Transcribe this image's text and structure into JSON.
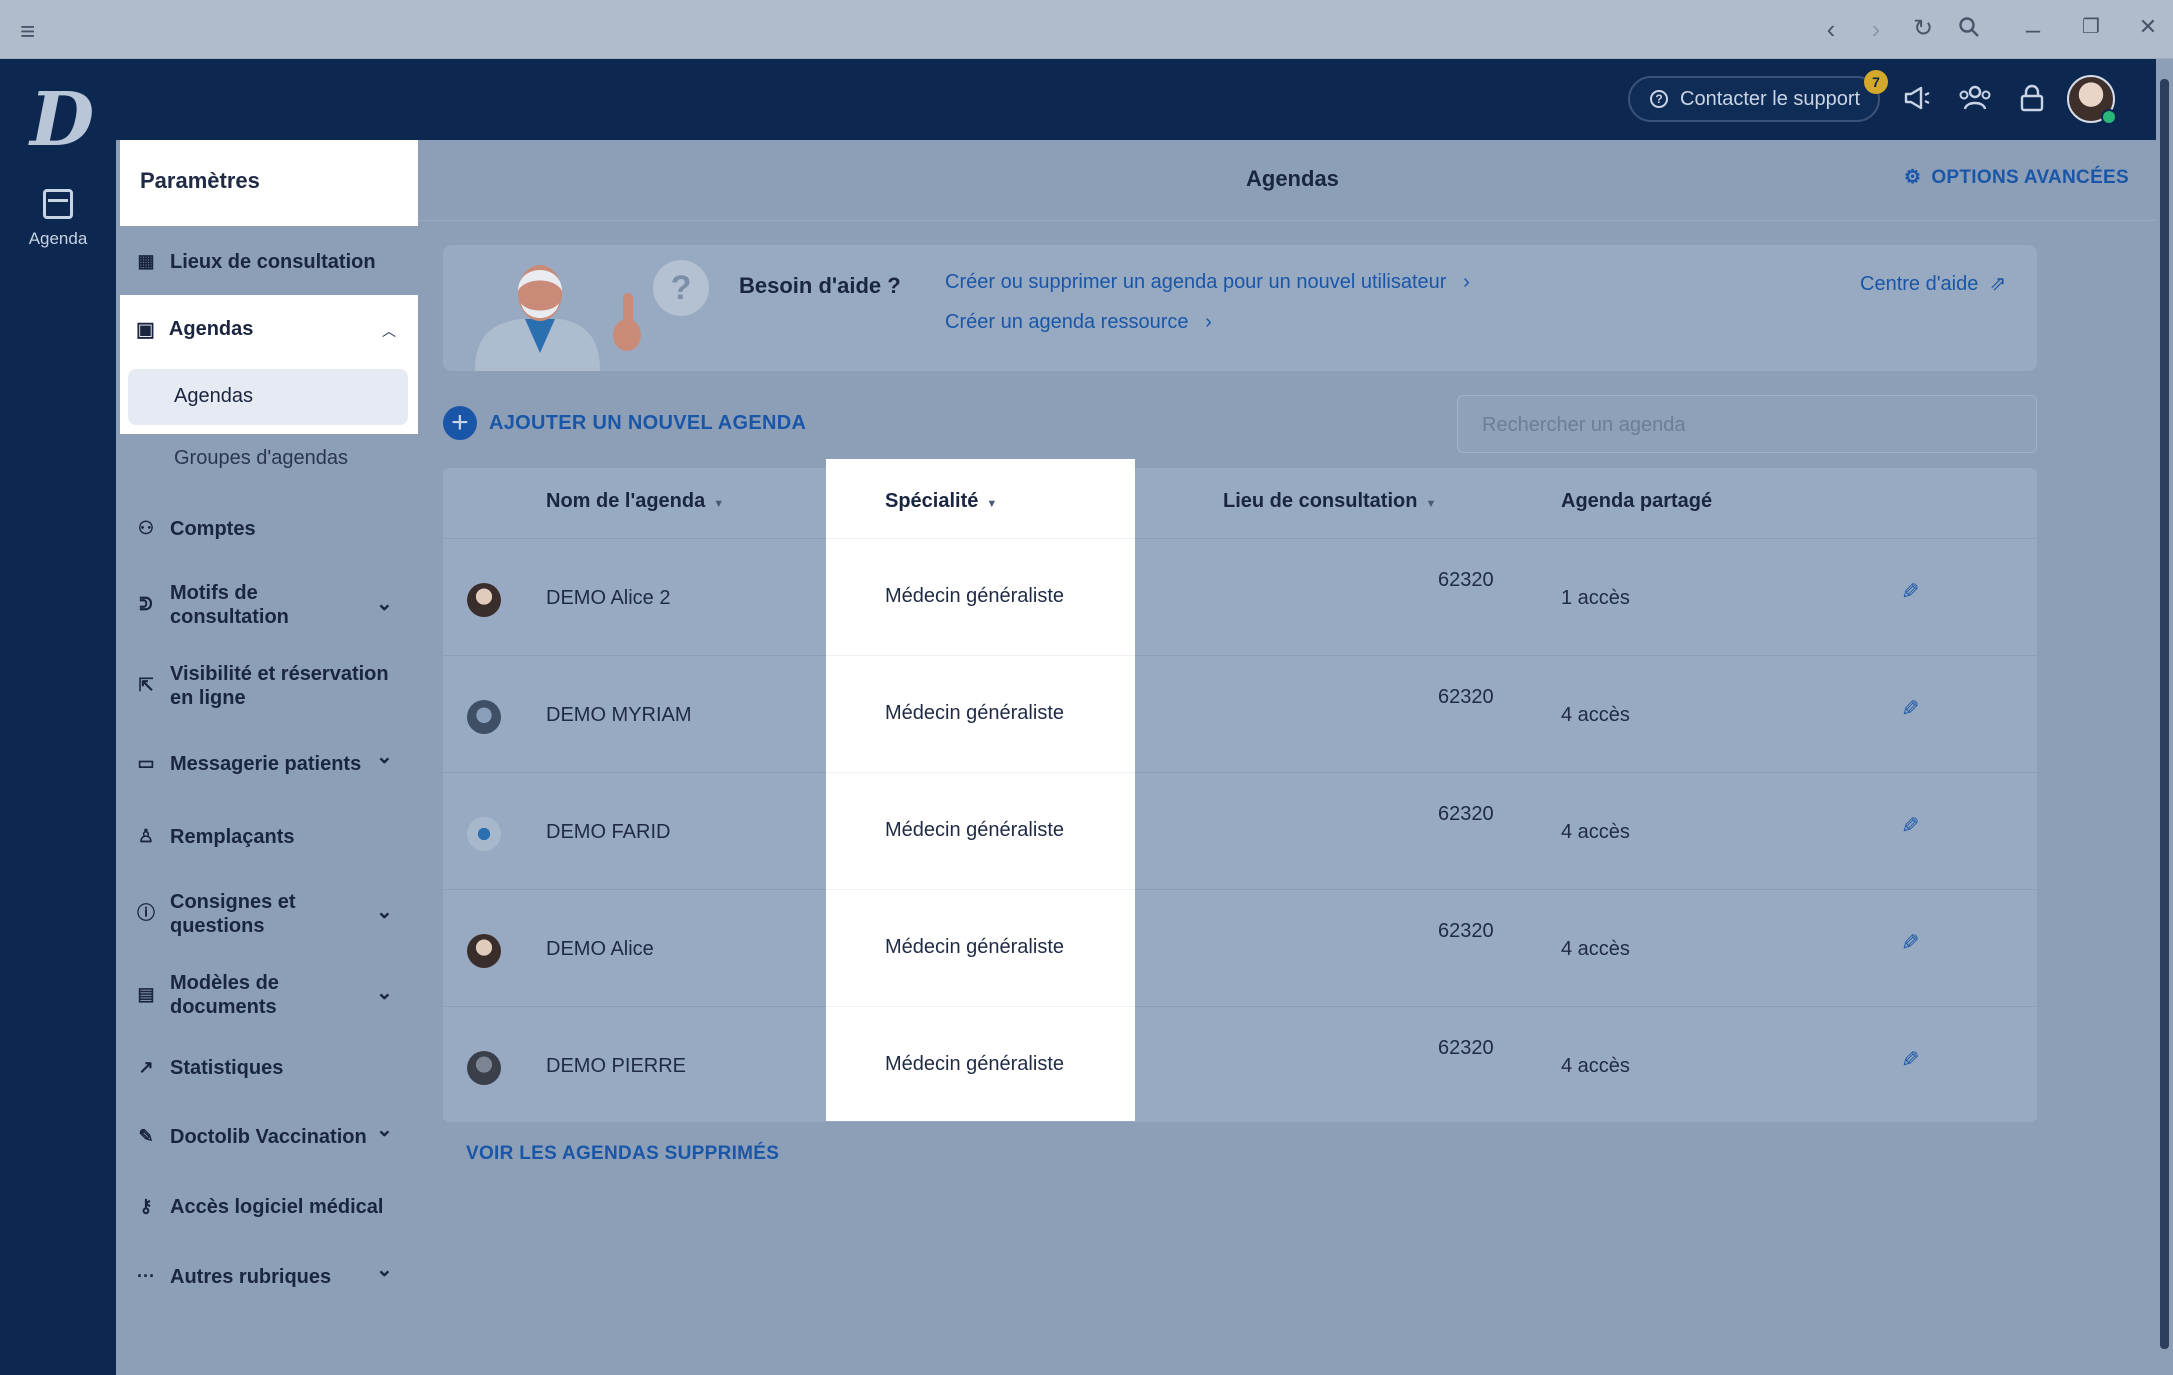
{
  "browser": {
    "menu_icon": "hamburger-icon",
    "controls": [
      "back-icon",
      "forward-icon",
      "reload-icon",
      "search-icon",
      "minimize-icon",
      "restore-icon",
      "close-icon"
    ]
  },
  "rail": {
    "logo": "D",
    "agenda_label": "Agenda"
  },
  "topbar": {
    "support_label": "Contacter le support",
    "support_badge": "7"
  },
  "sidebar": {
    "title": "Paramètres",
    "lieux": "Lieux de consultation",
    "agendas": "Agendas",
    "agendas_sub_active": "Agendas",
    "agendas_sub_groups": "Groupes d'agendas",
    "comptes": "Comptes",
    "motifs": "Motifs de consultation",
    "visibilite": "Visibilité et réservation en ligne",
    "messagerie": "Messagerie patients",
    "remplacants": "Remplaçants",
    "consignes": "Consignes et questions",
    "modeles": "Modèles de documents",
    "statistiques": "Statistiques",
    "vaccination": "Doctolib Vaccination",
    "acces": "Accès logiciel médical",
    "autres": "Autres rubriques"
  },
  "main": {
    "title": "Agendas",
    "options": "OPTIONS AVANCÉES",
    "help_title": "Besoin d'aide ?",
    "help_link1": "Créer ou supprimer un agenda pour un nouvel utilisateur",
    "help_link2": "Créer un agenda ressource",
    "help_center": "Centre d'aide",
    "add_label": "AJOUTER UN NOUVEL AGENDA",
    "search_placeholder": "Rechercher un agenda",
    "deleted_link": "VOIR LES AGENDAS SUPPRIMÉS"
  },
  "table": {
    "headers": {
      "name": "Nom de l'agenda",
      "speciality": "Spécialité",
      "lieu": "Lieu de consultation",
      "shared": "Agenda partagé"
    },
    "rows": [
      {
        "name": "DEMO Alice 2",
        "speciality": "Médecin généraliste",
        "zip": "62320",
        "access": "1 accès"
      },
      {
        "name": "DEMO MYRIAM",
        "speciality": "Médecin généraliste",
        "zip": "62320",
        "access": "4 accès"
      },
      {
        "name": "DEMO FARID",
        "speciality": "Médecin généraliste",
        "zip": "62320",
        "access": "4 accès"
      },
      {
        "name": "DEMO Alice",
        "speciality": "Médecin généraliste",
        "zip": "62320",
        "access": "4 accès"
      },
      {
        "name": "DEMO PIERRE",
        "speciality": "Médecin généraliste",
        "zip": "62320",
        "access": "4 accès"
      }
    ]
  },
  "colors": {
    "navy": "#0c2750",
    "link_blue": "#1a56a8",
    "overlay": "#8d9fb7",
    "badge": "#d4a82a",
    "online": "#2ab87a"
  }
}
